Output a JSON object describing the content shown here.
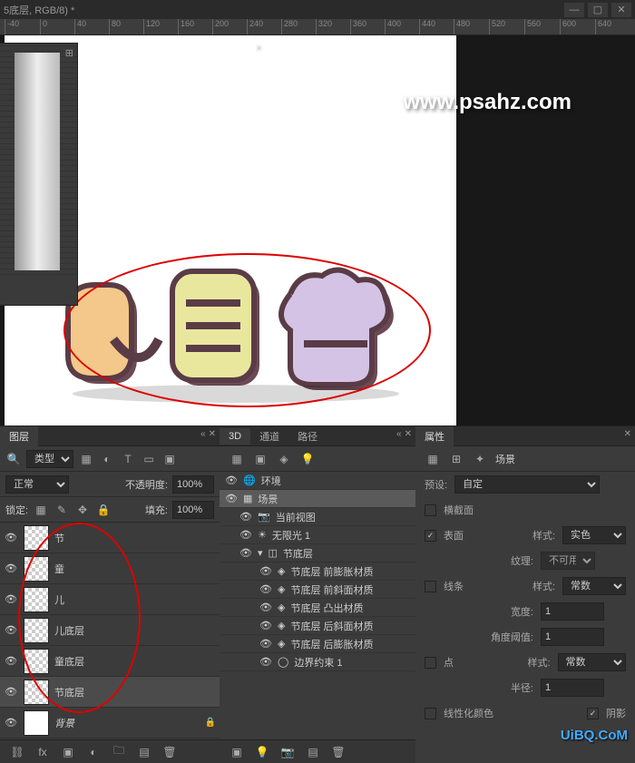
{
  "titlebar": {
    "title": "5底层, RGB/8) *"
  },
  "ruler_ticks": [
    "-40",
    "0",
    "40",
    "80",
    "120",
    "160",
    "200",
    "240",
    "280",
    "320",
    "360",
    "400",
    "440",
    "480",
    "520",
    "560",
    "600",
    "640"
  ],
  "watermark": "www.psahz.com",
  "layers_panel": {
    "tab": "图层",
    "kind_label": "类型",
    "blend_mode": "正常",
    "opacity_label": "不透明度:",
    "opacity_value": "100%",
    "lock_label": "锁定:",
    "fill_label": "填充:",
    "fill_value": "100%",
    "layers": [
      {
        "name": "节",
        "thumb": "checker"
      },
      {
        "name": "童",
        "thumb": "checker"
      },
      {
        "name": "儿",
        "thumb": "checker"
      },
      {
        "name": "儿底层",
        "thumb": "checker"
      },
      {
        "name": "童底层",
        "thumb": "checker"
      },
      {
        "name": "节底层",
        "thumb": "checker",
        "selected": true
      },
      {
        "name": "背景",
        "thumb": "white",
        "locked": true,
        "italic": true
      }
    ]
  },
  "three_d_panel": {
    "tabs": [
      "3D",
      "通道",
      "路径"
    ],
    "items": [
      {
        "label": "环境",
        "icon": "globe"
      },
      {
        "label": "场景",
        "icon": "grid",
        "selected": true
      },
      {
        "label": "当前视图",
        "icon": "camera",
        "indent": 1
      },
      {
        "label": "无限光 1",
        "icon": "sun",
        "indent": 1
      },
      {
        "label": "节底层",
        "icon": "mesh",
        "indent": 1,
        "expand": true
      },
      {
        "label": "节底层 前膨胀材质",
        "icon": "mat",
        "indent": 2
      },
      {
        "label": "节底层 前斜面材质",
        "icon": "mat",
        "indent": 2
      },
      {
        "label": "节底层 凸出材质",
        "icon": "mat",
        "indent": 2
      },
      {
        "label": "节底层 后斜面材质",
        "icon": "mat",
        "indent": 2
      },
      {
        "label": "节底层 后膨胀材质",
        "icon": "mat",
        "indent": 2
      },
      {
        "label": "边界约束 1",
        "icon": "circle",
        "indent": 2
      }
    ]
  },
  "props_panel": {
    "tab": "属性",
    "scene_label": "场景",
    "preset_label": "预设:",
    "preset_value": "自定",
    "cross_section": "横截面",
    "surface": {
      "label": "表面",
      "checked": true,
      "style_label": "样式:",
      "style_value": "实色",
      "texture_label": "纹理:",
      "texture_value": "不可用"
    },
    "lines": {
      "label": "线条",
      "style_label": "样式:",
      "style_value": "常数",
      "width_label": "宽度:",
      "width_value": "1",
      "angle_label": "角度阈值:",
      "angle_value": "1"
    },
    "points": {
      "label": "点",
      "style_label": "样式:",
      "style_value": "常数",
      "radius_label": "半径:",
      "radius_value": "1"
    },
    "linearize_label": "线性化颜色",
    "shadow_label": "阴影",
    "shadow_checked": true
  },
  "footer_watermark": "UiBQ.CoM"
}
